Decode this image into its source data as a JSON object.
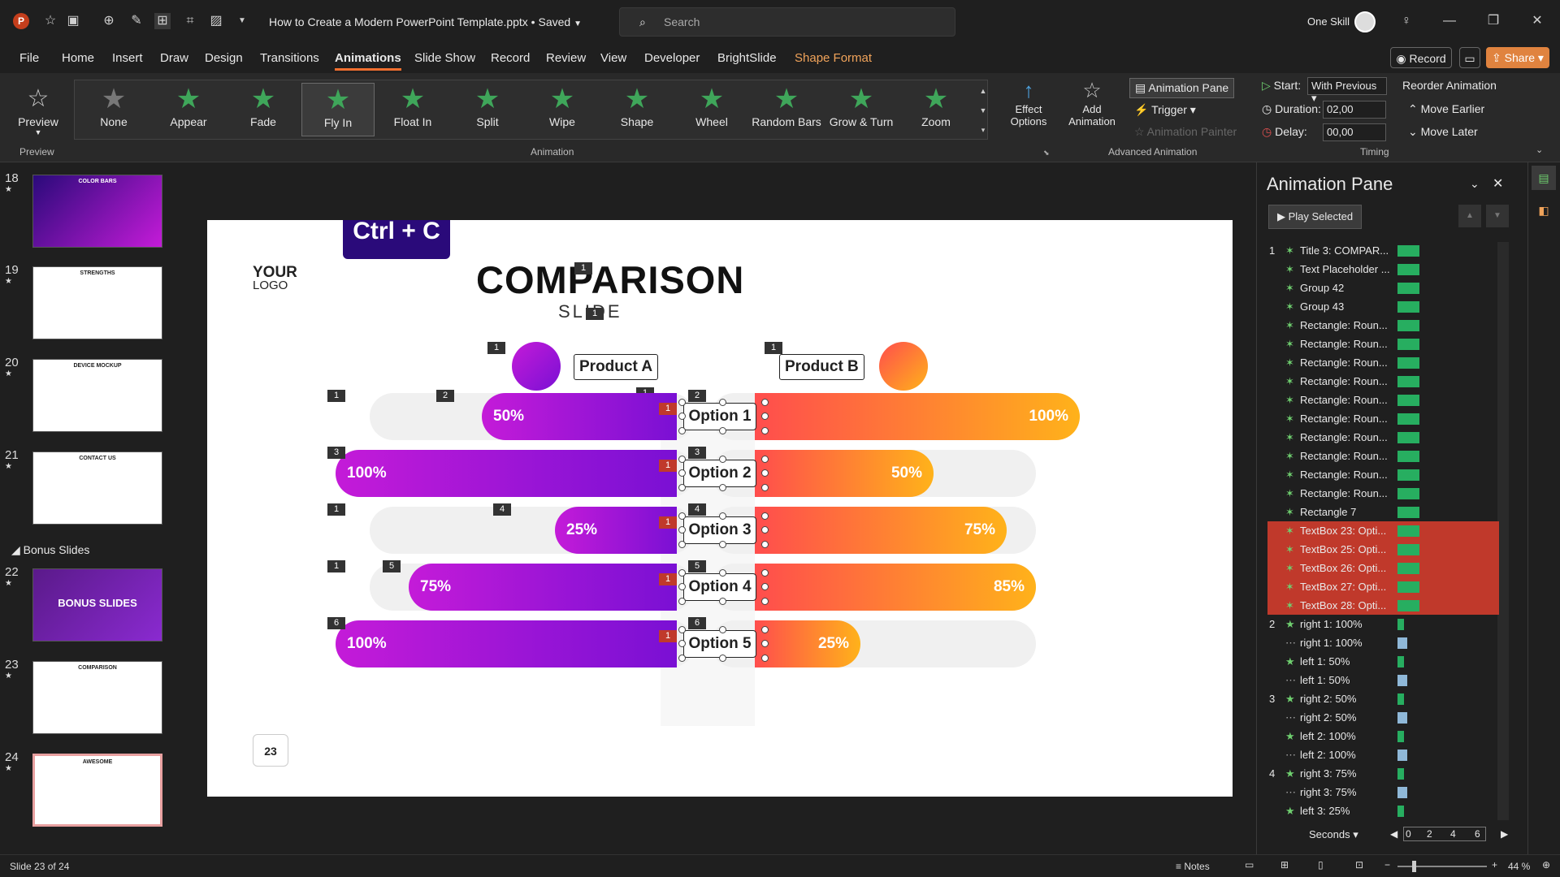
{
  "window": {
    "title": "How to Create a Modern PowerPoint Template.pptx • Saved",
    "search_placeholder": "Search",
    "user": "One Skill"
  },
  "menu": {
    "items": [
      "File",
      "Home",
      "Insert",
      "Draw",
      "Design",
      "Transitions",
      "Animations",
      "Slide Show",
      "Record",
      "Review",
      "View",
      "Developer",
      "BrightSlide",
      "Shape Format"
    ],
    "active": "Animations",
    "record_btn": "Record",
    "share_btn": "Share"
  },
  "ribbon": {
    "preview": "Preview",
    "preview_group": "Preview",
    "effects": [
      "None",
      "Appear",
      "Fade",
      "Fly In",
      "Float In",
      "Split",
      "Wipe",
      "Shape",
      "Wheel",
      "Random Bars",
      "Grow & Turn",
      "Zoom"
    ],
    "selected_effect": "Fly In",
    "effect_options": "Effect Options",
    "animation_group": "Animation",
    "add_animation": "Add Animation",
    "animation_pane_btn": "Animation Pane",
    "trigger": "Trigger",
    "animation_painter": "Animation Painter",
    "advanced_group": "Advanced Animation",
    "start_label": "Start:",
    "start_value": "With Previous",
    "duration_label": "Duration:",
    "duration_value": "02,00",
    "delay_label": "Delay:",
    "delay_value": "00,00",
    "reorder": "Reorder Animation",
    "move_earlier": "Move Earlier",
    "move_later": "Move Later",
    "timing_group": "Timing"
  },
  "thumbnails": [
    {
      "num": "18",
      "label": "COLOR BARS"
    },
    {
      "num": "19",
      "label": "STRENGTHS"
    },
    {
      "num": "20",
      "label": "DEVICE MOCKUP"
    },
    {
      "num": "21",
      "label": "CONTACT US"
    },
    {
      "num": "22",
      "label": "BONUS SLIDES"
    },
    {
      "num": "23",
      "label": "COMPARISON"
    },
    {
      "num": "24",
      "label": "AWESOME"
    }
  ],
  "section_label": "Bonus Slides",
  "slide": {
    "shortcut": "Ctrl + C",
    "logo_top": "YOUR",
    "logo_bottom": "LOGO",
    "title": "COMPARISON",
    "subtitle": "SLIDE",
    "product_a": "Product A",
    "product_b": "Product B",
    "slide_number": "23",
    "rows": [
      {
        "option": "Option 1",
        "left": "50%",
        "right": "100%",
        "left_frac": 0.5,
        "right_frac": 1.0
      },
      {
        "option": "Option 2",
        "left": "100%",
        "right": "50%",
        "left_frac": 1.0,
        "right_frac": 0.5
      },
      {
        "option": "Option 3",
        "left": "25%",
        "right": "75%",
        "left_frac": 0.25,
        "right_frac": 0.75
      },
      {
        "option": "Option 4",
        "left": "75%",
        "right": "85%",
        "left_frac": 0.75,
        "right_frac": 0.85
      },
      {
        "option": "Option 5",
        "left": "100%",
        "right": "25%",
        "left_frac": 1.0,
        "right_frac": 0.25
      }
    ]
  },
  "animation_pane": {
    "title": "Animation Pane",
    "play_selected": "Play Selected",
    "items": [
      {
        "num": "1",
        "label": "Title 3: COMPAR...",
        "hl": false,
        "type": "fly"
      },
      {
        "num": "",
        "label": "Text Placeholder ...",
        "hl": false,
        "type": "fly"
      },
      {
        "num": "",
        "label": "Group 42",
        "hl": false,
        "type": "fly"
      },
      {
        "num": "",
        "label": "Group 43",
        "hl": false,
        "type": "fly"
      },
      {
        "num": "",
        "label": "Rectangle: Roun...",
        "hl": false,
        "type": "fly"
      },
      {
        "num": "",
        "label": "Rectangle: Roun...",
        "hl": false,
        "type": "fly"
      },
      {
        "num": "",
        "label": "Rectangle: Roun...",
        "hl": false,
        "type": "fly"
      },
      {
        "num": "",
        "label": "Rectangle: Roun...",
        "hl": false,
        "type": "fly"
      },
      {
        "num": "",
        "label": "Rectangle: Roun...",
        "hl": false,
        "type": "fly"
      },
      {
        "num": "",
        "label": "Rectangle: Roun...",
        "hl": false,
        "type": "fly"
      },
      {
        "num": "",
        "label": "Rectangle: Roun...",
        "hl": false,
        "type": "fly"
      },
      {
        "num": "",
        "label": "Rectangle: Roun...",
        "hl": false,
        "type": "fly"
      },
      {
        "num": "",
        "label": "Rectangle: Roun...",
        "hl": false,
        "type": "fly"
      },
      {
        "num": "",
        "label": "Rectangle: Roun...",
        "hl": false,
        "type": "fly"
      },
      {
        "num": "",
        "label": "Rectangle 7",
        "hl": false,
        "type": "fly"
      },
      {
        "num": "",
        "label": "TextBox 23: Opti...",
        "hl": true,
        "type": "fly"
      },
      {
        "num": "",
        "label": "TextBox 25: Opti...",
        "hl": true,
        "type": "fly"
      },
      {
        "num": "",
        "label": "TextBox 26: Opti...",
        "hl": true,
        "type": "fly"
      },
      {
        "num": "",
        "label": "TextBox 27: Opti...",
        "hl": true,
        "type": "fly"
      },
      {
        "num": "",
        "label": "TextBox 28: Opti...",
        "hl": true,
        "type": "fly"
      },
      {
        "num": "2",
        "label": "right 1: 100%",
        "hl": false,
        "type": "appear"
      },
      {
        "num": "",
        "label": "right 1: 100%",
        "hl": false,
        "type": "path"
      },
      {
        "num": "",
        "label": "left 1: 50%",
        "hl": false,
        "type": "appear"
      },
      {
        "num": "",
        "label": "left 1: 50%",
        "hl": false,
        "type": "path"
      },
      {
        "num": "3",
        "label": "right 2: 50%",
        "hl": false,
        "type": "appear"
      },
      {
        "num": "",
        "label": "right 2: 50%",
        "hl": false,
        "type": "path"
      },
      {
        "num": "",
        "label": "left 2: 100%",
        "hl": false,
        "type": "appear"
      },
      {
        "num": "",
        "label": "left 2: 100%",
        "hl": false,
        "type": "path"
      },
      {
        "num": "4",
        "label": "right 3: 75%",
        "hl": false,
        "type": "appear"
      },
      {
        "num": "",
        "label": "right 3: 75%",
        "hl": false,
        "type": "path"
      },
      {
        "num": "",
        "label": "left 3: 25%",
        "hl": false,
        "type": "appear"
      }
    ],
    "seconds": "Seconds",
    "timeline": [
      "0",
      "2",
      "4",
      "6"
    ]
  },
  "status": {
    "slide_info": "Slide 23 of 24",
    "notes": "Notes",
    "zoom": "44 %"
  },
  "colors": {
    "accent": "#f26f2f",
    "purple": "#c41bd8",
    "orange": "#ffb21a",
    "highlight": "#c0392b"
  }
}
